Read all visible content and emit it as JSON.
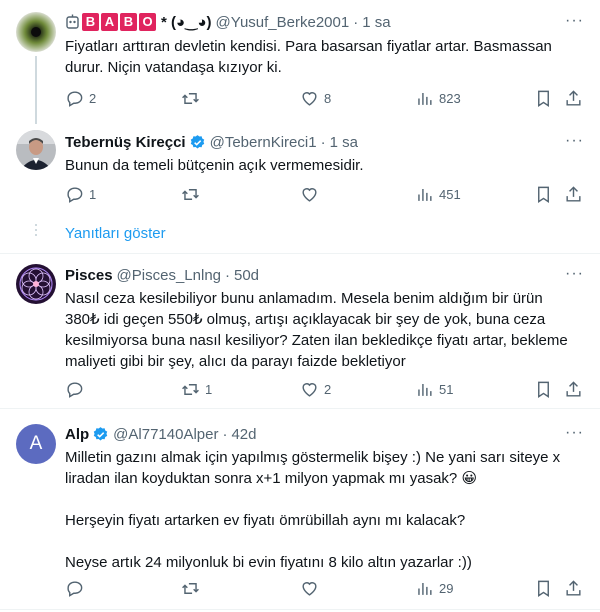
{
  "tweets": [
    {
      "name": "",
      "name_extra": "* (◕‿◕)",
      "badge_letters": [
        "B",
        "A",
        "B",
        "O"
      ],
      "handle": "@Yusuf_Berke2001",
      "time": "1 sa",
      "text": [
        "Fiyatları arttıran devletin kendisi. Para basarsan fiyatlar artar. Basmassan durur. Niçin vatandaşa kızıyor ki."
      ],
      "replies": "2",
      "retweets": "",
      "likes": "8",
      "views": "823"
    },
    {
      "name": "Tebernüş Kireçci",
      "handle": "@TebernKireci1",
      "time": "1 sa",
      "text": [
        "Bunun da temeli bütçenin açık vermemesidir."
      ],
      "replies": "1",
      "retweets": "",
      "likes": "",
      "views": "451"
    },
    {
      "name": "Pisces",
      "handle": "@Pisces_Lnlng",
      "time": "50d",
      "text": [
        "Nasıl ceza kesilebiliyor bunu anlamadım. Mesela benim aldığım bir ürün 380₺ idi geçen 550₺ olmuş, artışı açıklayacak bir şey de yok, buna ceza kesilmiyorsa buna nasıl kesiliyor? Zaten ilan bekledikçe fiyatı artar, bekleme maliyeti gibi bir şey, alıcı da parayı faizde bekletiyor"
      ],
      "replies": "",
      "retweets": "1",
      "likes": "2",
      "views": "51"
    },
    {
      "name": "Alp",
      "avatar_letter": "A",
      "handle": "@Al77140Alper",
      "time": "42d",
      "text": [
        "Milletin gazını almak için yapılmış göstermelik bişey :) Ne yani sarı siteye x liradan ilan koyduktan sonra x+1 milyon yapmak mı yasak? 😀",
        "Herşeyin fiyatı artarken ev fiyatı ömrübillah aynı mı kalacak?",
        "Neyse artık 24 milyonluk bi evin fiyatını 8 kilo altın yazarlar :))"
      ],
      "replies": "",
      "retweets": "",
      "likes": "",
      "views": "29"
    }
  ],
  "show_replies": "Yanıtları göster",
  "more_icon": "more-horizontal-icon",
  "colors": {
    "accent": "#1d9bf0",
    "muted": "#536471",
    "badge": "#e0245e",
    "alp_avatar": "#5c6bc0"
  }
}
